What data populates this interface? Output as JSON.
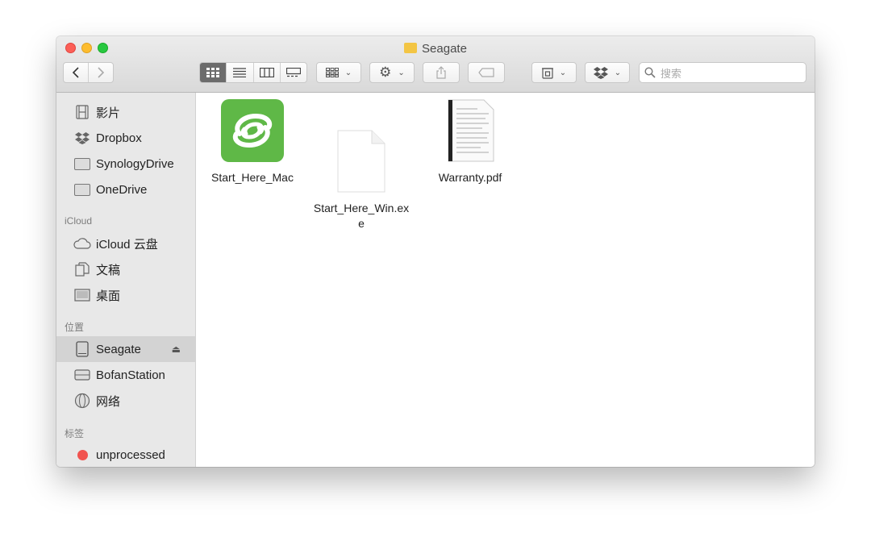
{
  "window": {
    "title": "Seagate"
  },
  "toolbar": {
    "search_placeholder": "搜索",
    "icons": [
      "back-icon",
      "forward-icon",
      "icon-view-icon",
      "list-view-icon",
      "column-view-icon",
      "gallery-view-icon",
      "group-icon",
      "gear-icon",
      "share-icon",
      "tag-icon",
      "archive-icon",
      "dropbox-icon",
      "search-icon"
    ]
  },
  "sidebar": {
    "items_top": [
      {
        "label": "影片",
        "icon": "film-icon"
      },
      {
        "label": "Dropbox",
        "icon": "dropbox-icon"
      },
      {
        "label": "SynologyDrive",
        "icon": "folder-icon"
      },
      {
        "label": "OneDrive",
        "icon": "folder-icon"
      }
    ],
    "icloud_header": "iCloud",
    "icloud_items": [
      {
        "label": "iCloud 云盘",
        "icon": "cloud-icon"
      },
      {
        "label": "文稿",
        "icon": "document-icon"
      },
      {
        "label": "桌面",
        "icon": "desktop-icon"
      }
    ],
    "locations_header": "位置",
    "locations_items": [
      {
        "label": "Seagate",
        "icon": "drive-icon",
        "selected": true
      },
      {
        "label": "BofanStation",
        "icon": "server-icon"
      },
      {
        "label": "网络",
        "icon": "network-icon"
      }
    ],
    "tags_header": "标签",
    "tags_items": [
      {
        "label": "unprocessed",
        "color": "#f1534f"
      }
    ]
  },
  "files": [
    {
      "name": "Start_Here_Mac",
      "icon": "seagate-app-icon"
    },
    {
      "name": "Start_Here_Win.ex\ne",
      "icon": "blank-document-icon"
    },
    {
      "name": "Warranty.pdf",
      "icon": "pdf-document-icon"
    }
  ],
  "colors": {
    "seagate_green": "#5fb847",
    "tag_red": "#f1534f",
    "selected_row": "#d3d3d3"
  }
}
